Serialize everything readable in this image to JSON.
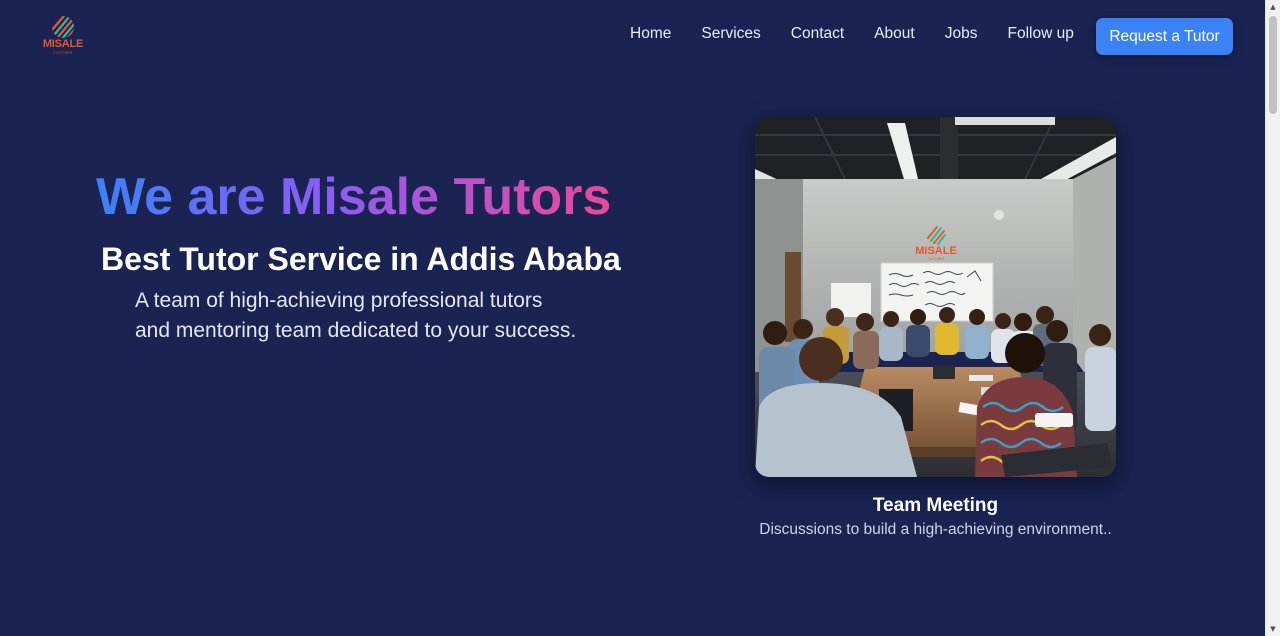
{
  "logo": {
    "name": "MISALE",
    "subtitle": "TUTORS"
  },
  "nav": {
    "items": [
      {
        "label": "Home"
      },
      {
        "label": "Services"
      },
      {
        "label": "Contact"
      },
      {
        "label": "About"
      },
      {
        "label": "Jobs"
      },
      {
        "label": "Follow up"
      }
    ],
    "cta_label": "Request a Tutor"
  },
  "hero": {
    "title": "We are Misale Tutors",
    "subtitle": "Best Tutor Service in Addis Ababa",
    "description_line1": "A team of high-achieving professional tutors",
    "description_line2": "and mentoring team dedicated to your success."
  },
  "feature": {
    "caption_title": "Team Meeting",
    "caption_text": "Discussions to build a high-achieving environment..",
    "photo_logo_name": "MISALE",
    "photo_logo_subtitle": "TUTORS"
  },
  "colors": {
    "background": "#1a2352",
    "accent": "#3b82f6",
    "gradient_start": "#3b82f6",
    "gradient_mid": "#8b5cf6",
    "gradient_end": "#ec4899",
    "logo_orange": "#e5582c"
  }
}
